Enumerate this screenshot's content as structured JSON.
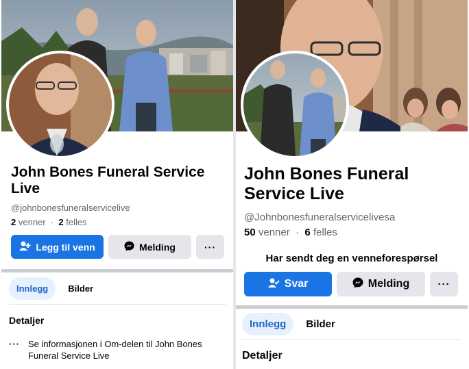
{
  "left": {
    "name": "John Bones Funeral Service Live",
    "handle": "@johnbonesfuneralservicelive",
    "friends_count": "2",
    "friends_label": "venner",
    "mutual_count": "2",
    "mutual_label": "felles",
    "add_friend_label": "Legg til venn",
    "message_label": "Melding",
    "more_label": "···",
    "tabs": [
      {
        "label": "Innlegg"
      },
      {
        "label": "Bilder"
      }
    ],
    "details_title": "Detaljer",
    "detail_text": "Se informasjonen i Om-delen til John Bones Funeral Service Live",
    "detail_icon": "more-dots-icon"
  },
  "right": {
    "name": "John Bones Funeral Service Live",
    "handle": "@Johnbonesfuneralservicelivesa",
    "friends_count": "50",
    "friends_label": "venner",
    "mutual_count": "6",
    "mutual_label": "felles",
    "request_notice": "Har sendt deg en venneforespørsel",
    "respond_label": "Svar",
    "message_label": "Melding",
    "more_label": "···",
    "tabs": [
      {
        "label": "Innlegg"
      },
      {
        "label": "Bilder"
      }
    ],
    "details_title": "Detaljer"
  },
  "colors": {
    "primary": "#1b74e4",
    "secondary_button": "#e4e6eb",
    "active_tab_bg": "#e7f0fd",
    "active_tab_text": "#1b66c9",
    "muted_text": "#65676b"
  },
  "icons": {
    "add_friend": "person-plus-icon",
    "respond": "person-check-icon",
    "message": "messenger-icon",
    "more": "more-dots-icon"
  }
}
